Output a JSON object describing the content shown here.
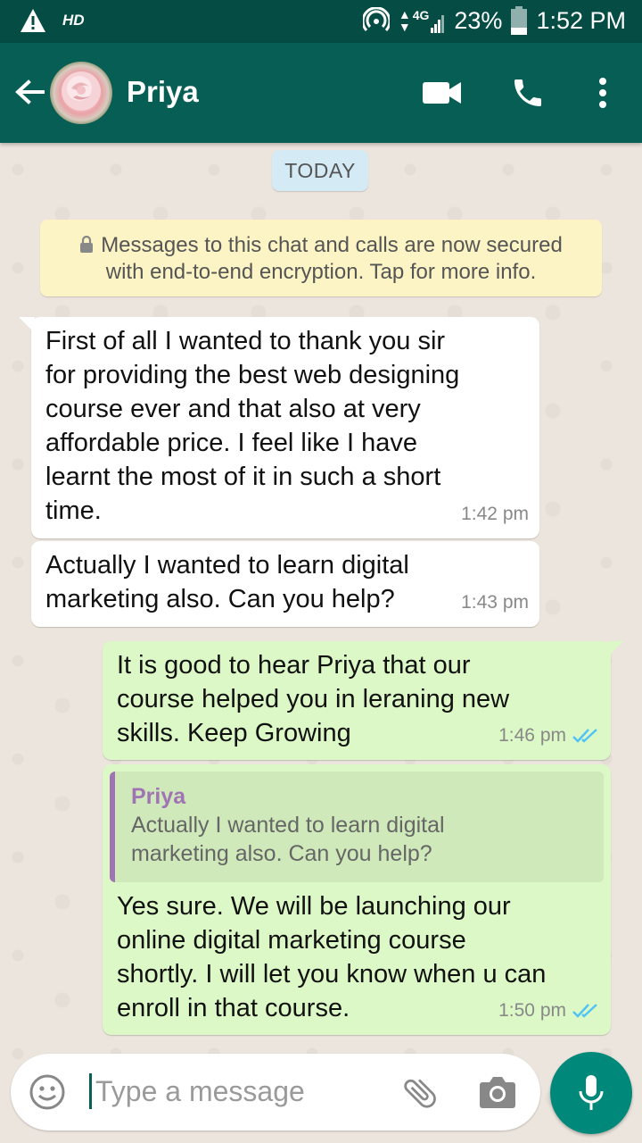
{
  "statusbar": {
    "network_label": "HD",
    "signal_type": "4G",
    "battery": "23%",
    "time": "1:52 PM"
  },
  "header": {
    "contact_name": "Priya"
  },
  "chat": {
    "date_chip": "TODAY",
    "encryption_notice_line1": "Messages to this chat and calls are now secured",
    "encryption_notice_line2": "with end-to-end encryption. Tap for more info.",
    "messages": [
      {
        "direction": "incoming",
        "lines": [
          "First of all I wanted to thank you sir",
          "for providing the best web designing",
          "course ever and that also at very",
          "affordable price. I feel like I have",
          "learnt the most of it in such a short",
          "time."
        ],
        "time": "1:42 pm"
      },
      {
        "direction": "incoming",
        "lines": [
          "Actually I wanted to learn digital",
          "marketing also. Can you help?"
        ],
        "time": "1:43 pm"
      },
      {
        "direction": "outgoing",
        "lines": [
          "It is good to hear Priya that our",
          "course helped you in leraning new",
          "skills. Keep Growing"
        ],
        "time": "1:46 pm",
        "status": "read"
      },
      {
        "direction": "outgoing",
        "quote": {
          "name": "Priya",
          "lines": [
            "Actually I wanted to learn digital",
            "marketing also. Can you help?"
          ]
        },
        "lines": [
          "Yes sure. We will be launching our",
          "online digital marketing course",
          "shortly. I will let you know when u can",
          "enroll in that course."
        ],
        "time": "1:50 pm",
        "status": "read"
      }
    ]
  },
  "composer": {
    "placeholder": "Type a message"
  },
  "colors": {
    "header": "#075e54",
    "statusbar": "#054d44",
    "outgoing_bubble": "#dcf8c6",
    "read_ticks": "#4fc3f7",
    "mic_button": "#00897b"
  }
}
